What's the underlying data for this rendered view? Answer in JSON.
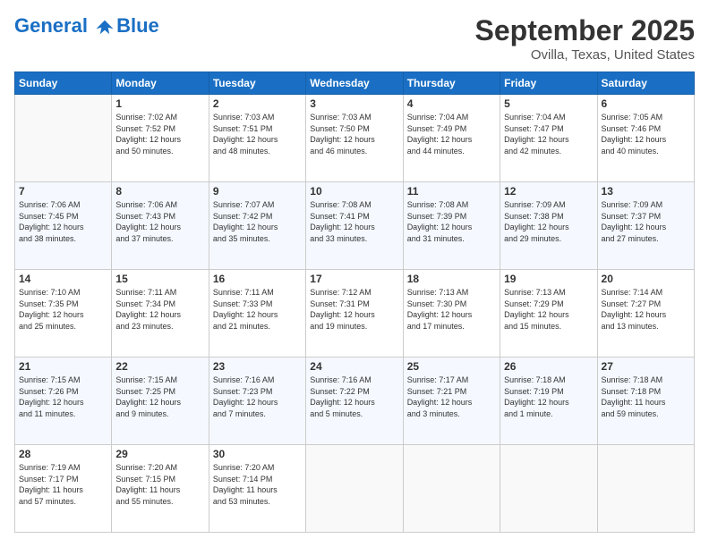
{
  "header": {
    "logo_line1": "General",
    "logo_line2": "Blue",
    "month": "September 2025",
    "location": "Ovilla, Texas, United States"
  },
  "days_of_week": [
    "Sunday",
    "Monday",
    "Tuesday",
    "Wednesday",
    "Thursday",
    "Friday",
    "Saturday"
  ],
  "weeks": [
    [
      {
        "day": "",
        "info": ""
      },
      {
        "day": "1",
        "info": "Sunrise: 7:02 AM\nSunset: 7:52 PM\nDaylight: 12 hours\nand 50 minutes."
      },
      {
        "day": "2",
        "info": "Sunrise: 7:03 AM\nSunset: 7:51 PM\nDaylight: 12 hours\nand 48 minutes."
      },
      {
        "day": "3",
        "info": "Sunrise: 7:03 AM\nSunset: 7:50 PM\nDaylight: 12 hours\nand 46 minutes."
      },
      {
        "day": "4",
        "info": "Sunrise: 7:04 AM\nSunset: 7:49 PM\nDaylight: 12 hours\nand 44 minutes."
      },
      {
        "day": "5",
        "info": "Sunrise: 7:04 AM\nSunset: 7:47 PM\nDaylight: 12 hours\nand 42 minutes."
      },
      {
        "day": "6",
        "info": "Sunrise: 7:05 AM\nSunset: 7:46 PM\nDaylight: 12 hours\nand 40 minutes."
      }
    ],
    [
      {
        "day": "7",
        "info": "Sunrise: 7:06 AM\nSunset: 7:45 PM\nDaylight: 12 hours\nand 38 minutes."
      },
      {
        "day": "8",
        "info": "Sunrise: 7:06 AM\nSunset: 7:43 PM\nDaylight: 12 hours\nand 37 minutes."
      },
      {
        "day": "9",
        "info": "Sunrise: 7:07 AM\nSunset: 7:42 PM\nDaylight: 12 hours\nand 35 minutes."
      },
      {
        "day": "10",
        "info": "Sunrise: 7:08 AM\nSunset: 7:41 PM\nDaylight: 12 hours\nand 33 minutes."
      },
      {
        "day": "11",
        "info": "Sunrise: 7:08 AM\nSunset: 7:39 PM\nDaylight: 12 hours\nand 31 minutes."
      },
      {
        "day": "12",
        "info": "Sunrise: 7:09 AM\nSunset: 7:38 PM\nDaylight: 12 hours\nand 29 minutes."
      },
      {
        "day": "13",
        "info": "Sunrise: 7:09 AM\nSunset: 7:37 PM\nDaylight: 12 hours\nand 27 minutes."
      }
    ],
    [
      {
        "day": "14",
        "info": "Sunrise: 7:10 AM\nSunset: 7:35 PM\nDaylight: 12 hours\nand 25 minutes."
      },
      {
        "day": "15",
        "info": "Sunrise: 7:11 AM\nSunset: 7:34 PM\nDaylight: 12 hours\nand 23 minutes."
      },
      {
        "day": "16",
        "info": "Sunrise: 7:11 AM\nSunset: 7:33 PM\nDaylight: 12 hours\nand 21 minutes."
      },
      {
        "day": "17",
        "info": "Sunrise: 7:12 AM\nSunset: 7:31 PM\nDaylight: 12 hours\nand 19 minutes."
      },
      {
        "day": "18",
        "info": "Sunrise: 7:13 AM\nSunset: 7:30 PM\nDaylight: 12 hours\nand 17 minutes."
      },
      {
        "day": "19",
        "info": "Sunrise: 7:13 AM\nSunset: 7:29 PM\nDaylight: 12 hours\nand 15 minutes."
      },
      {
        "day": "20",
        "info": "Sunrise: 7:14 AM\nSunset: 7:27 PM\nDaylight: 12 hours\nand 13 minutes."
      }
    ],
    [
      {
        "day": "21",
        "info": "Sunrise: 7:15 AM\nSunset: 7:26 PM\nDaylight: 12 hours\nand 11 minutes."
      },
      {
        "day": "22",
        "info": "Sunrise: 7:15 AM\nSunset: 7:25 PM\nDaylight: 12 hours\nand 9 minutes."
      },
      {
        "day": "23",
        "info": "Sunrise: 7:16 AM\nSunset: 7:23 PM\nDaylight: 12 hours\nand 7 minutes."
      },
      {
        "day": "24",
        "info": "Sunrise: 7:16 AM\nSunset: 7:22 PM\nDaylight: 12 hours\nand 5 minutes."
      },
      {
        "day": "25",
        "info": "Sunrise: 7:17 AM\nSunset: 7:21 PM\nDaylight: 12 hours\nand 3 minutes."
      },
      {
        "day": "26",
        "info": "Sunrise: 7:18 AM\nSunset: 7:19 PM\nDaylight: 12 hours\nand 1 minute."
      },
      {
        "day": "27",
        "info": "Sunrise: 7:18 AM\nSunset: 7:18 PM\nDaylight: 11 hours\nand 59 minutes."
      }
    ],
    [
      {
        "day": "28",
        "info": "Sunrise: 7:19 AM\nSunset: 7:17 PM\nDaylight: 11 hours\nand 57 minutes."
      },
      {
        "day": "29",
        "info": "Sunrise: 7:20 AM\nSunset: 7:15 PM\nDaylight: 11 hours\nand 55 minutes."
      },
      {
        "day": "30",
        "info": "Sunrise: 7:20 AM\nSunset: 7:14 PM\nDaylight: 11 hours\nand 53 minutes."
      },
      {
        "day": "",
        "info": ""
      },
      {
        "day": "",
        "info": ""
      },
      {
        "day": "",
        "info": ""
      },
      {
        "day": "",
        "info": ""
      }
    ]
  ]
}
